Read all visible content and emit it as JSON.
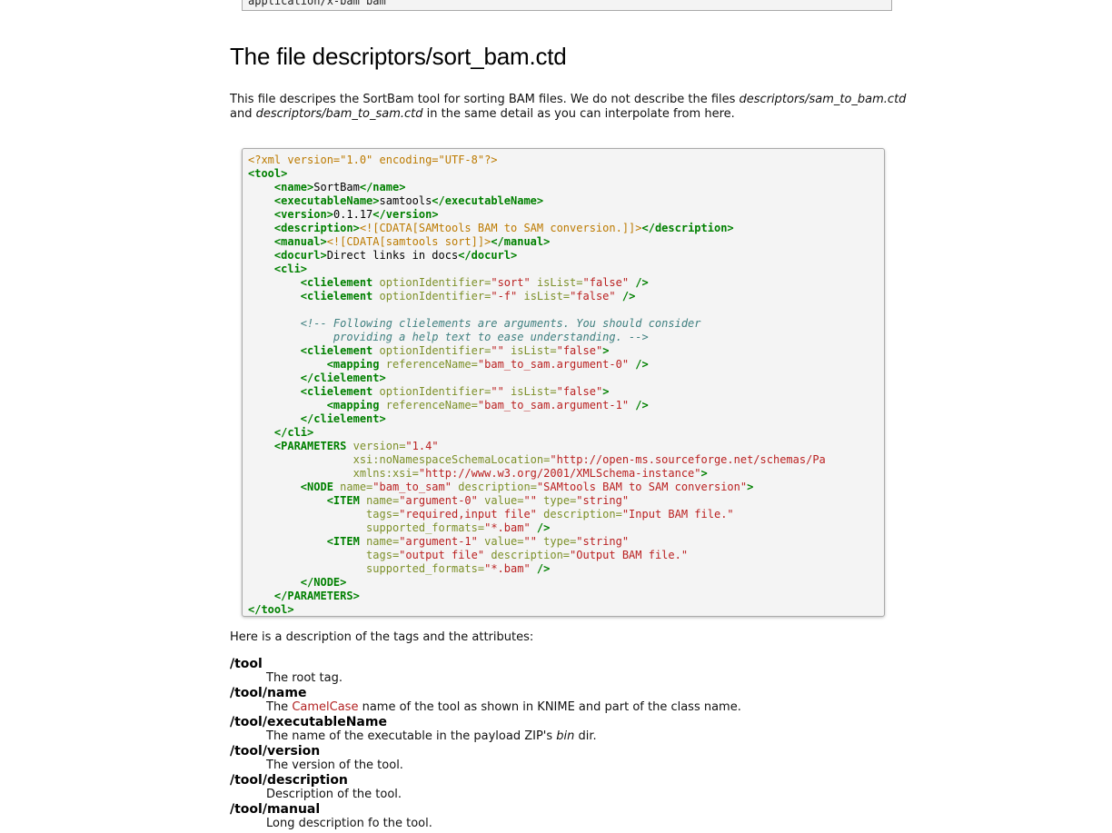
{
  "top_code": {
    "text": "application/x-bam bam"
  },
  "section": {
    "heading": "The file descriptors/sort_bam.ctd",
    "intro": {
      "p1": "This file descripes the SortBam tool for sorting BAM files. We do not describe the files ",
      "em1": "descriptors/sam_to_bam.ctd",
      "p2": " and ",
      "em2": "descriptors/bam_to_sam.ctd",
      "p3": " in the same detail as you can interpolate from here."
    }
  },
  "code_lines": [
    [
      [
        "pi",
        "<?xml version=\"1.0\" encoding=\"UTF-8\"?>"
      ]
    ],
    [
      [
        "tag",
        "<tool>"
      ]
    ],
    [
      [
        "txt",
        "    "
      ],
      [
        "tag",
        "<name>"
      ],
      [
        "txt",
        "SortBam"
      ],
      [
        "tag",
        "</name>"
      ]
    ],
    [
      [
        "txt",
        "    "
      ],
      [
        "tag",
        "<executableName>"
      ],
      [
        "txt",
        "samtools"
      ],
      [
        "tag",
        "</executableName>"
      ]
    ],
    [
      [
        "txt",
        "    "
      ],
      [
        "tag",
        "<version>"
      ],
      [
        "txt",
        "0.1.17"
      ],
      [
        "tag",
        "</version>"
      ]
    ],
    [
      [
        "txt",
        "    "
      ],
      [
        "tag",
        "<description>"
      ],
      [
        "cdata",
        "<![CDATA[SAMtools BAM to SAM conversion.]]>"
      ],
      [
        "tag",
        "</description>"
      ]
    ],
    [
      [
        "txt",
        "    "
      ],
      [
        "tag",
        "<manual>"
      ],
      [
        "cdata",
        "<![CDATA[samtools sort]]>"
      ],
      [
        "tag",
        "</manual>"
      ]
    ],
    [
      [
        "txt",
        "    "
      ],
      [
        "tag",
        "<docurl>"
      ],
      [
        "txt",
        "Direct links in docs"
      ],
      [
        "tag",
        "</docurl>"
      ]
    ],
    [
      [
        "txt",
        "    "
      ],
      [
        "tag",
        "<cli>"
      ]
    ],
    [
      [
        "txt",
        "        "
      ],
      [
        "tag",
        "<clielement"
      ],
      [
        "txt",
        " "
      ],
      [
        "attr",
        "optionIdentifier="
      ],
      [
        "val",
        "\"sort\""
      ],
      [
        "txt",
        " "
      ],
      [
        "attr",
        "isList="
      ],
      [
        "val",
        "\"false\""
      ],
      [
        "txt",
        " "
      ],
      [
        "tag",
        "/>"
      ]
    ],
    [
      [
        "txt",
        "        "
      ],
      [
        "tag",
        "<clielement"
      ],
      [
        "txt",
        " "
      ],
      [
        "attr",
        "optionIdentifier="
      ],
      [
        "val",
        "\"-f\""
      ],
      [
        "txt",
        " "
      ],
      [
        "attr",
        "isList="
      ],
      [
        "val",
        "\"false\""
      ],
      [
        "txt",
        " "
      ],
      [
        "tag",
        "/>"
      ]
    ],
    [
      [
        "txt",
        ""
      ]
    ],
    [
      [
        "txt",
        "        "
      ],
      [
        "cmt",
        "<!-- Following clielements are arguments. You should consider"
      ]
    ],
    [
      [
        "cmt",
        "             providing a help text to ease understanding. -->"
      ]
    ],
    [
      [
        "txt",
        "        "
      ],
      [
        "tag",
        "<clielement"
      ],
      [
        "txt",
        " "
      ],
      [
        "attr",
        "optionIdentifier="
      ],
      [
        "val",
        "\"\""
      ],
      [
        "txt",
        " "
      ],
      [
        "attr",
        "isList="
      ],
      [
        "val",
        "\"false\""
      ],
      [
        "tag",
        ">"
      ]
    ],
    [
      [
        "txt",
        "            "
      ],
      [
        "tag",
        "<mapping"
      ],
      [
        "txt",
        " "
      ],
      [
        "attr",
        "referenceName="
      ],
      [
        "val",
        "\"bam_to_sam.argument-0\""
      ],
      [
        "txt",
        " "
      ],
      [
        "tag",
        "/>"
      ]
    ],
    [
      [
        "txt",
        "        "
      ],
      [
        "tag",
        "</clielement>"
      ]
    ],
    [
      [
        "txt",
        "        "
      ],
      [
        "tag",
        "<clielement"
      ],
      [
        "txt",
        " "
      ],
      [
        "attr",
        "optionIdentifier="
      ],
      [
        "val",
        "\"\""
      ],
      [
        "txt",
        " "
      ],
      [
        "attr",
        "isList="
      ],
      [
        "val",
        "\"false\""
      ],
      [
        "tag",
        ">"
      ]
    ],
    [
      [
        "txt",
        "            "
      ],
      [
        "tag",
        "<mapping"
      ],
      [
        "txt",
        " "
      ],
      [
        "attr",
        "referenceName="
      ],
      [
        "val",
        "\"bam_to_sam.argument-1\""
      ],
      [
        "txt",
        " "
      ],
      [
        "tag",
        "/>"
      ]
    ],
    [
      [
        "txt",
        "        "
      ],
      [
        "tag",
        "</clielement>"
      ]
    ],
    [
      [
        "txt",
        "    "
      ],
      [
        "tag",
        "</cli>"
      ]
    ],
    [
      [
        "txt",
        "    "
      ],
      [
        "tag",
        "<PARAMETERS"
      ],
      [
        "txt",
        " "
      ],
      [
        "attr",
        "version="
      ],
      [
        "val",
        "\"1.4\""
      ]
    ],
    [
      [
        "txt",
        "                "
      ],
      [
        "attr",
        "xsi:noNamespaceSchemaLocation="
      ],
      [
        "val",
        "\"http://open-ms.sourceforge.net/schemas/Pa"
      ]
    ],
    [
      [
        "txt",
        "                "
      ],
      [
        "attr",
        "xmlns:xsi="
      ],
      [
        "val",
        "\"http://www.w3.org/2001/XMLSchema-instance\""
      ],
      [
        "tag",
        ">"
      ]
    ],
    [
      [
        "txt",
        "        "
      ],
      [
        "tag",
        "<NODE"
      ],
      [
        "txt",
        " "
      ],
      [
        "attr",
        "name="
      ],
      [
        "val",
        "\"bam_to_sam\""
      ],
      [
        "txt",
        " "
      ],
      [
        "attr",
        "description="
      ],
      [
        "val",
        "\"SAMtools BAM to SAM conversion\""
      ],
      [
        "tag",
        ">"
      ]
    ],
    [
      [
        "txt",
        "            "
      ],
      [
        "tag",
        "<ITEM"
      ],
      [
        "txt",
        " "
      ],
      [
        "attr",
        "name="
      ],
      [
        "val",
        "\"argument-0\""
      ],
      [
        "txt",
        " "
      ],
      [
        "attr",
        "value="
      ],
      [
        "val",
        "\"\""
      ],
      [
        "txt",
        " "
      ],
      [
        "attr",
        "type="
      ],
      [
        "val",
        "\"string\""
      ]
    ],
    [
      [
        "txt",
        "                  "
      ],
      [
        "attr",
        "tags="
      ],
      [
        "val",
        "\"required,input file\""
      ],
      [
        "txt",
        " "
      ],
      [
        "attr",
        "description="
      ],
      [
        "val",
        "\"Input BAM file.\""
      ]
    ],
    [
      [
        "txt",
        "                  "
      ],
      [
        "attr",
        "supported_formats="
      ],
      [
        "val",
        "\"*.bam\""
      ],
      [
        "txt",
        " "
      ],
      [
        "tag",
        "/>"
      ]
    ],
    [
      [
        "txt",
        "            "
      ],
      [
        "tag",
        "<ITEM"
      ],
      [
        "txt",
        " "
      ],
      [
        "attr",
        "name="
      ],
      [
        "val",
        "\"argument-1\""
      ],
      [
        "txt",
        " "
      ],
      [
        "attr",
        "value="
      ],
      [
        "val",
        "\"\""
      ],
      [
        "txt",
        " "
      ],
      [
        "attr",
        "type="
      ],
      [
        "val",
        "\"string\""
      ]
    ],
    [
      [
        "txt",
        "                  "
      ],
      [
        "attr",
        "tags="
      ],
      [
        "val",
        "\"output file\""
      ],
      [
        "txt",
        " "
      ],
      [
        "attr",
        "description="
      ],
      [
        "val",
        "\"Output BAM file.\""
      ]
    ],
    [
      [
        "txt",
        "                  "
      ],
      [
        "attr",
        "supported_formats="
      ],
      [
        "val",
        "\"*.bam\""
      ],
      [
        "txt",
        " "
      ],
      [
        "tag",
        "/>"
      ]
    ],
    [
      [
        "txt",
        "        "
      ],
      [
        "tag",
        "</NODE>"
      ]
    ],
    [
      [
        "txt",
        "    "
      ],
      [
        "tag",
        "</PARAMETERS>"
      ]
    ],
    [
      [
        "tag",
        "</tool>"
      ]
    ]
  ],
  "tags_intro": "Here is a description of the tags and the attributes:",
  "definitions": {
    "tool": {
      "term": "/tool",
      "desc": "The root tag."
    },
    "name": {
      "term": "/tool/name",
      "before": "The ",
      "link": "CamelCase",
      "after": " name of the tool as shown in KNIME and part of the class name."
    },
    "executable": {
      "term": "/tool/executableName",
      "before": "The name of the executable in the payload ZIP's ",
      "em": "bin",
      "after": " dir."
    },
    "version": {
      "term": "/tool/version",
      "desc": "The version of the tool."
    },
    "description": {
      "term": "/tool/description",
      "desc": "Description of the tool."
    },
    "manual": {
      "term": "/tool/manual",
      "desc": "Long description fo the tool."
    }
  },
  "colors": {
    "pi": "#bc7a00",
    "tag": "#008000",
    "attr": "#7d9029",
    "val": "#ba2121",
    "comment": "#408080",
    "link": "#b22222"
  }
}
